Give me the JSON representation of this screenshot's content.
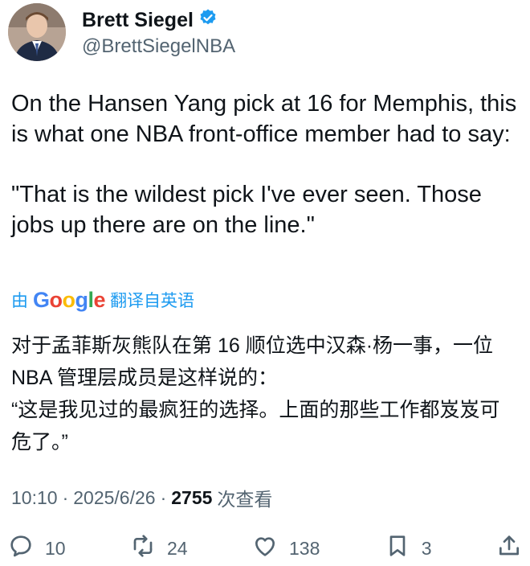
{
  "author": {
    "name": "Brett Siegel",
    "handle": "@BrettSiegelNBA",
    "verified_icon": "verified-badge-icon"
  },
  "tweet": {
    "paragraph_1": "On the Hansen Yang pick at 16 for Memphis, this is what one NBA front-office member had to say:",
    "paragraph_2": "\"That is the wildest pick I've ever seen. Those jobs up there are on the line.\""
  },
  "translation": {
    "prefix": "由",
    "provider": "Google",
    "suffix": "翻译自英语",
    "line_1": "对于孟菲斯灰熊队在第 16 顺位选中汉森·杨一事，一位",
    "line_2": "NBA 管理层成员是这样说的：",
    "line_3": "“这是我见过的最疯狂的选择。上面的那些工作都岌岌可",
    "line_4": "危了。”"
  },
  "meta": {
    "time": "10:10",
    "separator": "·",
    "date": "2025/6/26",
    "views_count": "2755",
    "views_label": "次查看"
  },
  "actions": {
    "replies": "10",
    "reposts": "24",
    "likes": "138",
    "bookmarks": "3"
  },
  "colors": {
    "text_primary": "#0f1419",
    "text_secondary": "#536471",
    "link_blue": "#1d9bf0",
    "verified_blue": "#1d9bf0"
  }
}
